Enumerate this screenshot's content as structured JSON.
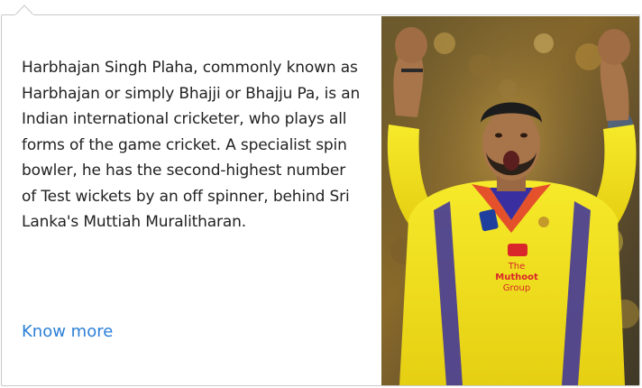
{
  "popover": {
    "description": "Harbhajan Singh Plaha, commonly known as Harbhajan or simply Bhajji or Bhajju Pa, is an Indian international cricketer, who plays all forms of the game cricket. A specialist spin bowler, he has the second-highest number of Test wickets by an off spinner, behind Sri Lanka's Muttiah Muralitharan.",
    "link_label": "Know more"
  },
  "photo": {
    "jersey_sponsor_line1": "The",
    "jersey_sponsor_line2": "Muthoot",
    "jersey_sponsor_line3": "Group"
  },
  "colors": {
    "link": "#2b7fd6",
    "border": "#c9c9c9",
    "jersey": "#f4e51c"
  }
}
